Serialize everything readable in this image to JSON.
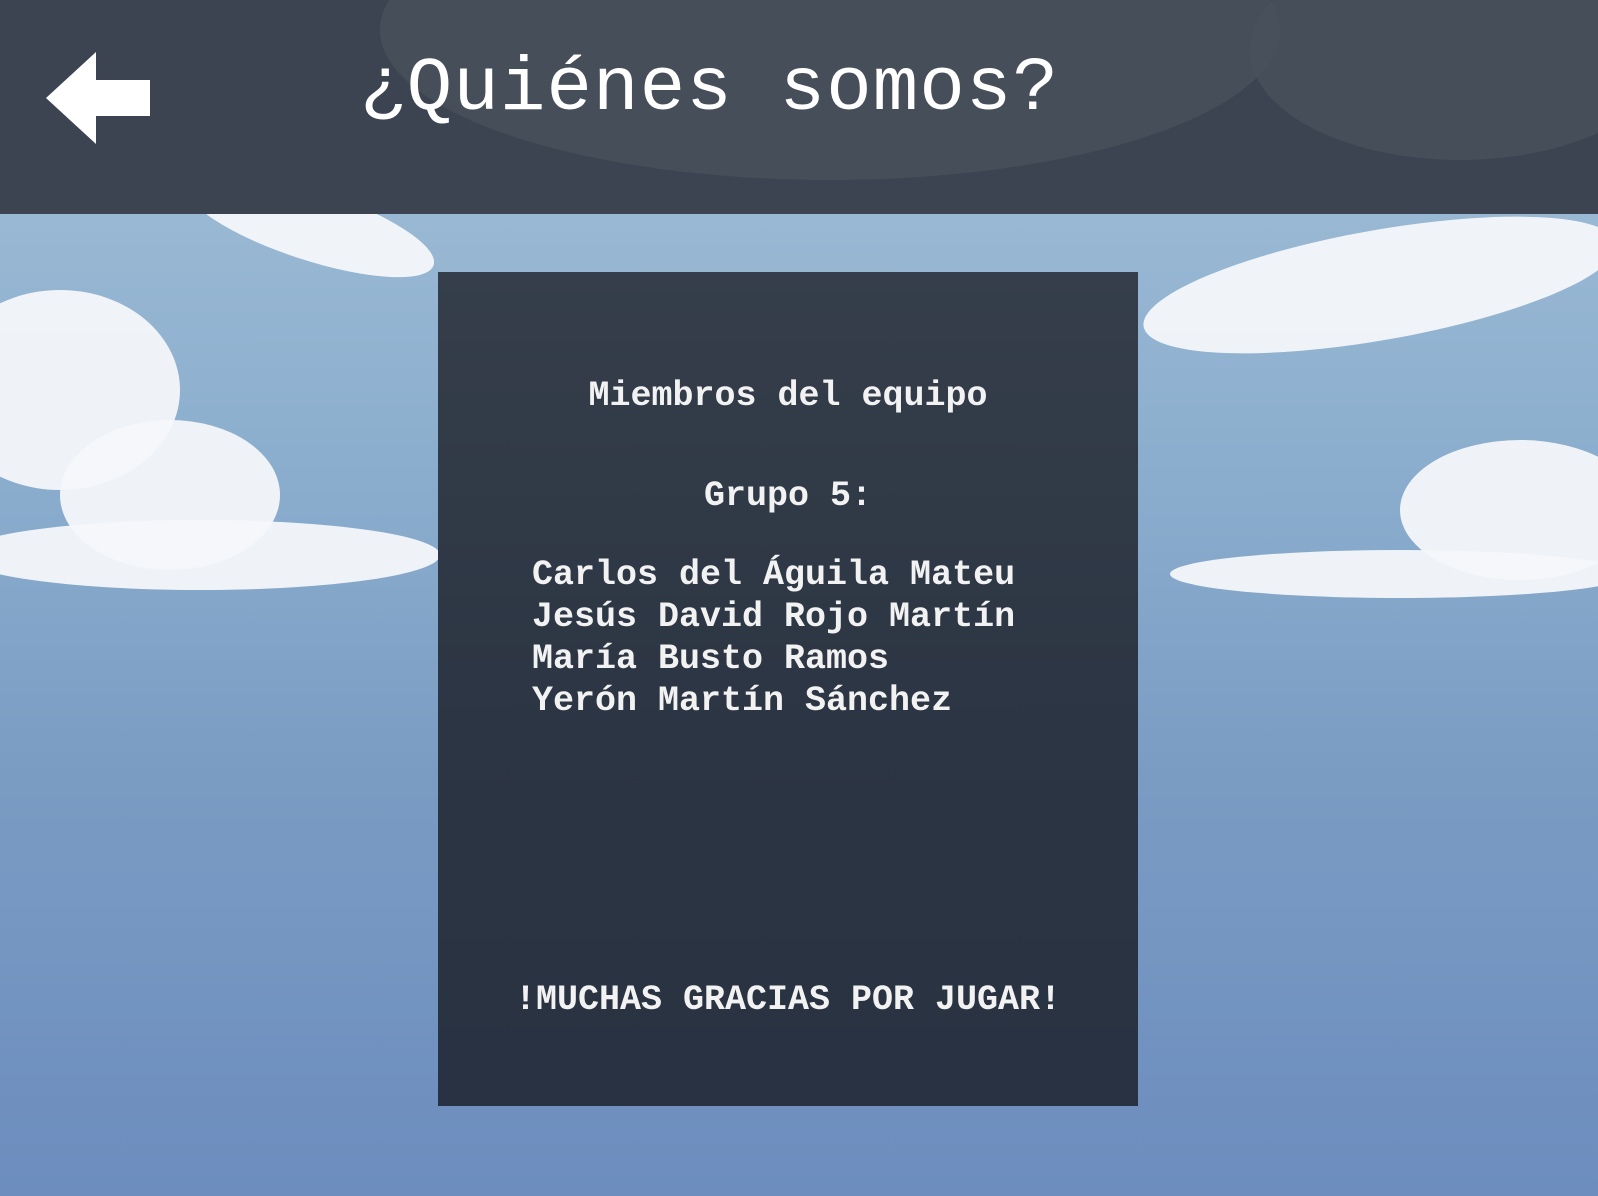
{
  "header": {
    "title": "¿Quiénes somos?",
    "back_icon": "arrow-left-icon"
  },
  "panel": {
    "heading": "Miembros del equipo",
    "group_label": "Grupo 5:",
    "members": [
      "Carlos del Águila Mateu",
      "Jesús David Rojo Martín",
      "María Busto Ramos",
      "Yerón Martín Sánchez"
    ],
    "thanks": "!MUCHAS GRACIAS POR JUGAR!"
  },
  "colors": {
    "header_bg": "#3b4450",
    "panel_bg": "#2c3543",
    "sky": "#8eb0cf",
    "text": "#f2f2f2"
  }
}
